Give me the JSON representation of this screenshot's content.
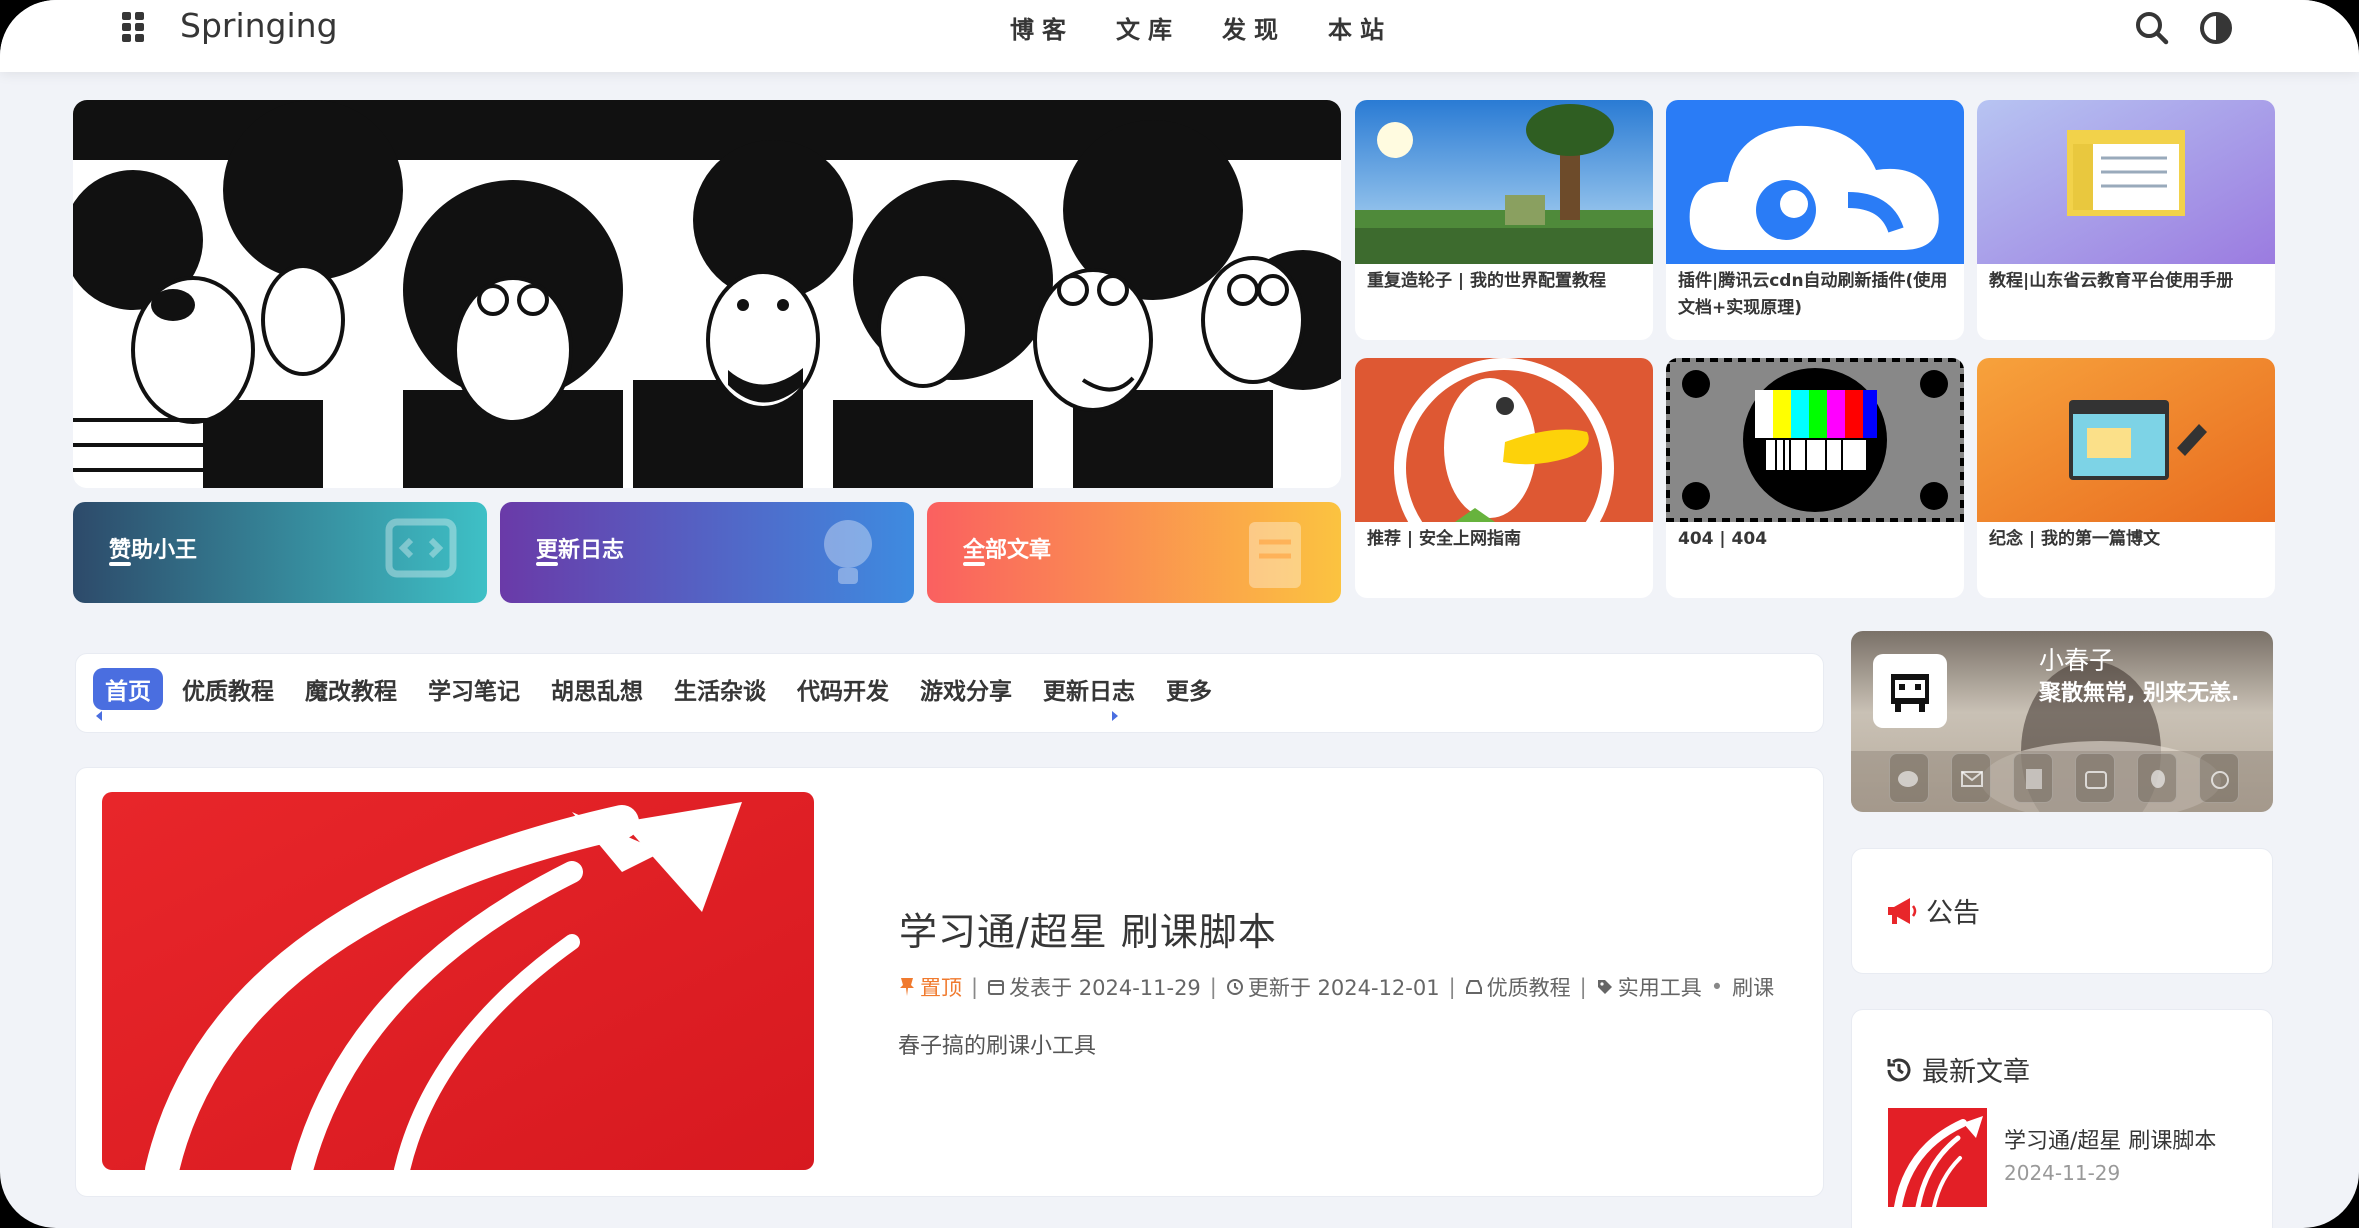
{
  "nav": {
    "site_title": "Springing",
    "links": [
      "博客",
      "文库",
      "发现",
      "本站"
    ],
    "icons": [
      "menu-icon",
      "search-icon",
      "theme-toggle-icon"
    ]
  },
  "quick_links": [
    {
      "label": "赞助小王",
      "icon": "code-window-icon"
    },
    {
      "label": "更新日志",
      "icon": "lightbulb-icon"
    },
    {
      "label": "全部文章",
      "icon": "book-icon"
    }
  ],
  "feature_cards": [
    {
      "title": "重复造轮子 | 我的世界配置教程"
    },
    {
      "title": "插件|腾讯云cdn自动刷新插件(使用文档+实现原理)"
    },
    {
      "title": "教程|山东省云教育平台使用手册"
    },
    {
      "title": "推荐 | 安全上网指南"
    },
    {
      "title": "404 | 404"
    },
    {
      "title": "纪念 | 我的第一篇博文"
    }
  ],
  "categories": {
    "tabs": [
      "首页",
      "优质教程",
      "魔改教程",
      "学习笔记",
      "胡思乱想",
      "生活杂谈",
      "代码开发",
      "游戏分享",
      "更新日志",
      "更多"
    ],
    "active_index": 0
  },
  "post": {
    "title": "学习通/超星 刷课脚本",
    "pinned": "置顶",
    "published": "发表于 2024-11-29",
    "updated": "更新于 2024-12-01",
    "category": "优质教程",
    "tag1": "实用工具",
    "tag_sep": "•",
    "tag2": "刷课",
    "excerpt": "春子搞的刷课小工具"
  },
  "profile": {
    "name": "小春子",
    "motto": "聚散無常, 别来无恙.",
    "socials": [
      "wechat-icon",
      "mail-icon",
      "doc-icon",
      "bilibili-icon",
      "qq-icon",
      "weibo-icon"
    ]
  },
  "notice": {
    "heading": "公告"
  },
  "latest": {
    "heading": "最新文章",
    "item_title": "学习通/超星 刷课脚本",
    "item_date": "2024-11-29"
  },
  "colors": {
    "accent": "#4a6ee0",
    "pin": "#f07a2e",
    "background": "#f1f3f8"
  }
}
